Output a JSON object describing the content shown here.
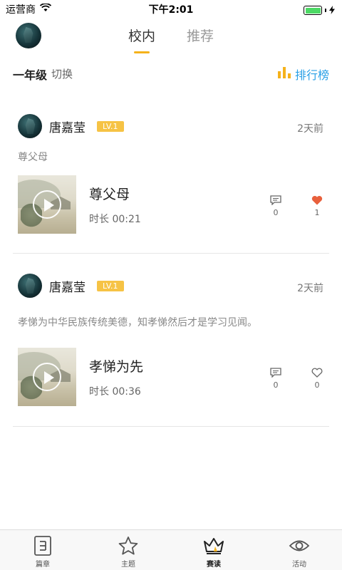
{
  "status_bar": {
    "carrier": "运营商",
    "time": "下午2:01",
    "battery_level": 1.0
  },
  "header": {
    "tabs": [
      {
        "label": "校内",
        "active": true
      },
      {
        "label": "推荐",
        "active": false
      }
    ]
  },
  "grade_bar": {
    "grade": "一年级",
    "switch_label": "切换",
    "rank_label": "排行榜"
  },
  "posts": [
    {
      "username": "唐嘉莹",
      "level": "LV.1",
      "time_ago": "2天前",
      "description": "尊父母",
      "media_title": "尊父母",
      "duration": "时长 00:21",
      "comments": "0",
      "likes": "1",
      "liked": true
    },
    {
      "username": "唐嘉莹",
      "level": "LV.1",
      "time_ago": "2天前",
      "description": "孝悌为中华民族传统美德，知孝悌然后才是学习见闻。",
      "media_title": "孝悌为先",
      "duration": "时长 00:36",
      "comments": "0",
      "likes": "0",
      "liked": false
    }
  ],
  "bottom_nav": [
    {
      "label": "篇章",
      "icon": "document-icon",
      "active": false
    },
    {
      "label": "主题",
      "icon": "star-icon",
      "active": false
    },
    {
      "label": "赛读",
      "icon": "crown-icon",
      "active": true
    },
    {
      "label": "活动",
      "icon": "eye-icon",
      "active": false
    }
  ],
  "colors": {
    "accent": "#f5b21b",
    "rank_blue": "#2aa0e6",
    "like_red": "#e8603c",
    "level_badge": "#f6c345"
  }
}
